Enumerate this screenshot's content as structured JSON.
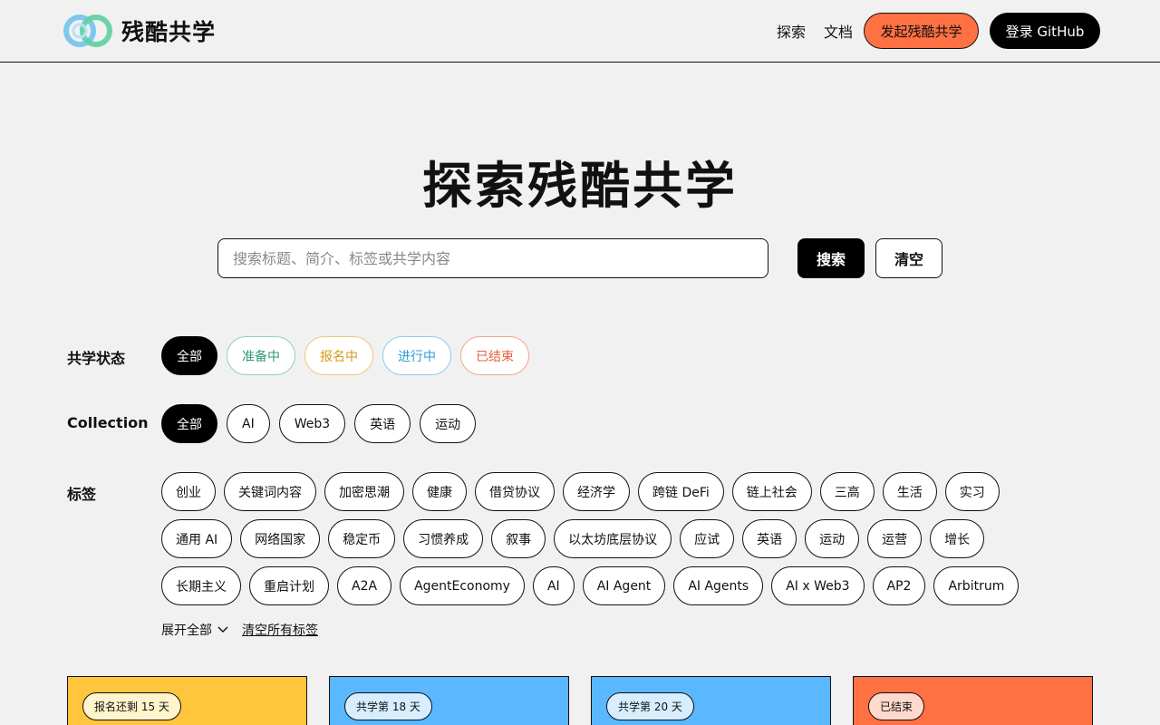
{
  "header": {
    "logo_text": "残酷共学",
    "nav": {
      "explore": "探索",
      "docs": "文档"
    },
    "launch_label": "发起残酷共学",
    "login_label": "登录 GitHub"
  },
  "hero": {
    "title": "探索残酷共学",
    "search_placeholder": "搜索标题、简介、标签或共学内容",
    "search_label": "搜索",
    "clear_label": "清空"
  },
  "filters": {
    "status": {
      "label": "共学状态",
      "options": [
        "全部",
        "准备中",
        "报名中",
        "进行中",
        "已结束"
      ]
    },
    "collection": {
      "label": "Collection",
      "options": [
        "全部",
        "AI",
        "Web3",
        "英语",
        "运动"
      ]
    },
    "tags": {
      "label": "标签",
      "rows": [
        [
          "创业",
          "关键词内容",
          "加密思潮",
          "健康",
          "借贷协议",
          "经济学",
          "跨链 DeFi",
          "链上社会",
          "三高",
          "生活",
          "实习"
        ],
        [
          "通用 AI",
          "网络国家",
          "稳定币",
          "习惯养成",
          "叙事",
          "以太坊底层协议",
          "应试",
          "英语",
          "运动",
          "运营",
          "增长"
        ],
        [
          "长期主义",
          "重启计划",
          "A2A",
          "AgentEconomy",
          "AI",
          "AI Agent",
          "AI Agents",
          "AI x Web3",
          "AP2",
          "Arbitrum"
        ]
      ],
      "expand_label": "展开全部",
      "clear_label": "清空所有标签"
    }
  },
  "cards": [
    {
      "badge": "报名还剩 15 天",
      "color": "#ffc53d",
      "badge_bg": "#fff4cc"
    },
    {
      "badge": "共学第 18 天",
      "color": "#59b8ff",
      "badge_bg": "#d6eeff"
    },
    {
      "badge": "共学第 20 天",
      "color": "#59b8ff",
      "badge_bg": "#d6eeff"
    },
    {
      "badge": "已结束",
      "color": "#ff7043",
      "badge_bg": "#ffd9cc"
    }
  ],
  "colors": {
    "accent_orange": "#ff7043",
    "black": "#000000",
    "status_prep": "#2e9a6e",
    "status_reg": "#d69a18",
    "status_run": "#2f9bd6",
    "status_end": "#e8603c"
  }
}
